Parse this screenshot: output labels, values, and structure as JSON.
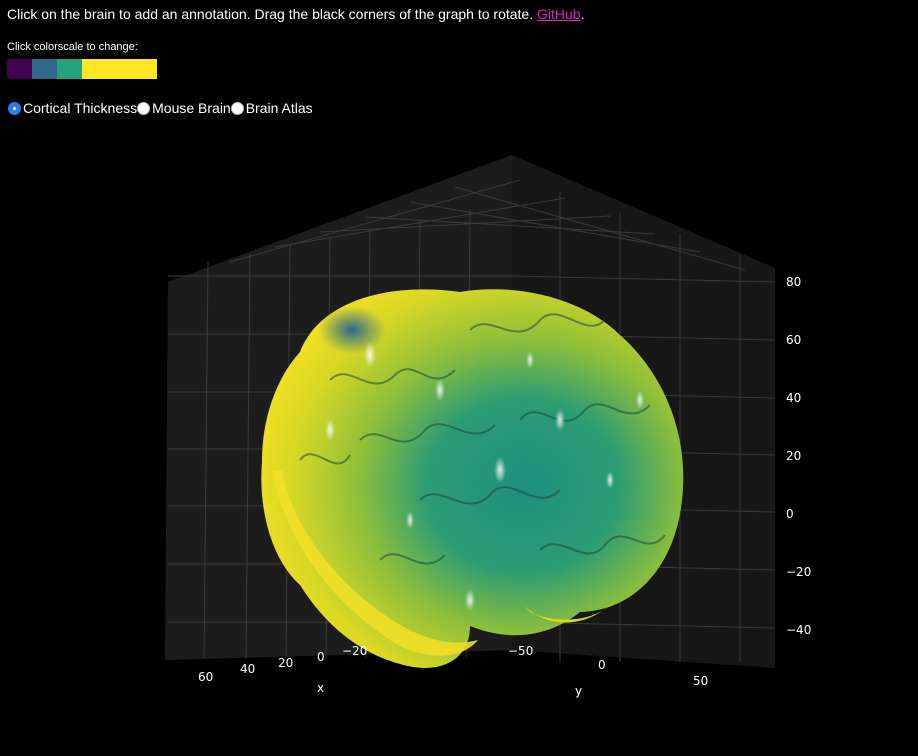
{
  "instructions": {
    "text": "Click on the brain to add an annotation. Drag the black corners of the graph to rotate. ",
    "link_label": "GitHub",
    "trailing": "."
  },
  "colorscale": {
    "title": "Click colorscale to change:",
    "swatches": [
      {
        "color": "#440154",
        "width_units": 1
      },
      {
        "color": "#31688e",
        "width_units": 1
      },
      {
        "color": "#26a37a",
        "width_units": 1
      },
      {
        "color": "#fde725",
        "width_units": 3
      }
    ]
  },
  "datasets": {
    "options": [
      "Cortical Thickness",
      "Mouse Brain",
      "Brain Atlas"
    ],
    "selected": "Cortical Thickness"
  },
  "axes": {
    "z_ticks": [
      "80",
      "60",
      "40",
      "20",
      "0",
      "−20",
      "−40"
    ],
    "x_ticks": [
      "60",
      "40",
      "20",
      "0",
      "−20"
    ],
    "y_ticks": [
      "−50",
      "0",
      "50"
    ],
    "x_label": "x",
    "y_label": "y"
  },
  "colors": {
    "background": "#000000",
    "link": "#e020c0",
    "radio_selected": "#2a7ff0"
  }
}
